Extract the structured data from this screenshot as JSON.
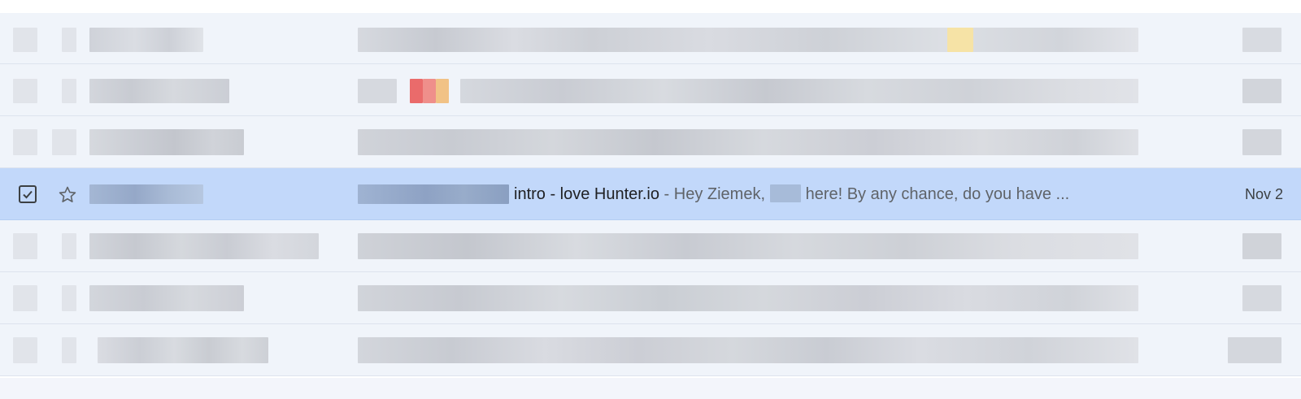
{
  "inbox": {
    "selected_row": {
      "subject": "intro - love Hunter.io",
      "snippet_separator": " - ",
      "snippet_greeting": "Hey Ziemek,",
      "snippet_rest": " here! By any chance, do you have ...",
      "date": "Nov 2",
      "checked": true,
      "starred": false
    }
  },
  "icons": {
    "checkbox": "checkbox-checked-icon",
    "star": "star-outline-icon"
  },
  "colors": {
    "row_background": "#f0f4fa",
    "selected_row_background": "#c2d8fa",
    "redaction_gray": "#c9ccd4"
  }
}
